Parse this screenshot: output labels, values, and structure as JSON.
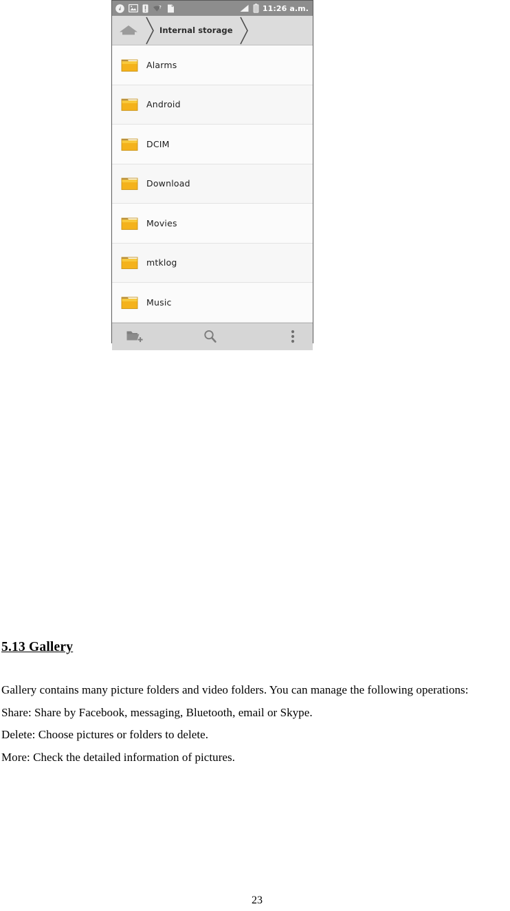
{
  "screenshot": {
    "status_bar": {
      "icons": [
        "music-note-icon",
        "image-icon",
        "warning-icon",
        "wifi-question-icon",
        "sd-card-icon"
      ],
      "signal_icon": "signal-bars-icon",
      "battery_icon": "battery-icon",
      "time": "11:26 a.m."
    },
    "breadcrumb": {
      "home_icon": "home-icon",
      "separator_icon": "chevron-right-icon",
      "path": "Internal storage"
    },
    "file_list": [
      {
        "name": "Alarms",
        "icon": "folder-icon"
      },
      {
        "name": "Android",
        "icon": "folder-icon"
      },
      {
        "name": "DCIM",
        "icon": "folder-icon"
      },
      {
        "name": "Download",
        "icon": "folder-icon"
      },
      {
        "name": "Movies",
        "icon": "folder-icon"
      },
      {
        "name": "mtklog",
        "icon": "folder-icon"
      },
      {
        "name": "Music",
        "icon": "folder-icon"
      }
    ],
    "toolbar": {
      "new_folder_icon": "new-folder-icon",
      "search_icon": "search-icon",
      "overflow_icon": "overflow-menu-icon"
    },
    "colors": {
      "status_bar_bg": "#8d8d8d",
      "breadcrumb_bg": "#dcdcdc",
      "toolbar_bg": "#d6d6d6",
      "folder_yellow": "#f5b81e",
      "folder_tab": "#b08a49"
    }
  },
  "document": {
    "heading": "5.13 Gallery",
    "paragraphs": [
      "Gallery contains many picture folders and video folders. You can manage the following operations:",
      "Share: Share by Facebook, messaging, Bluetooth, email or Skype.",
      "Delete: Choose pictures or folders to delete.",
      "More: Check the detailed information of pictures."
    ],
    "page_number": "23"
  }
}
